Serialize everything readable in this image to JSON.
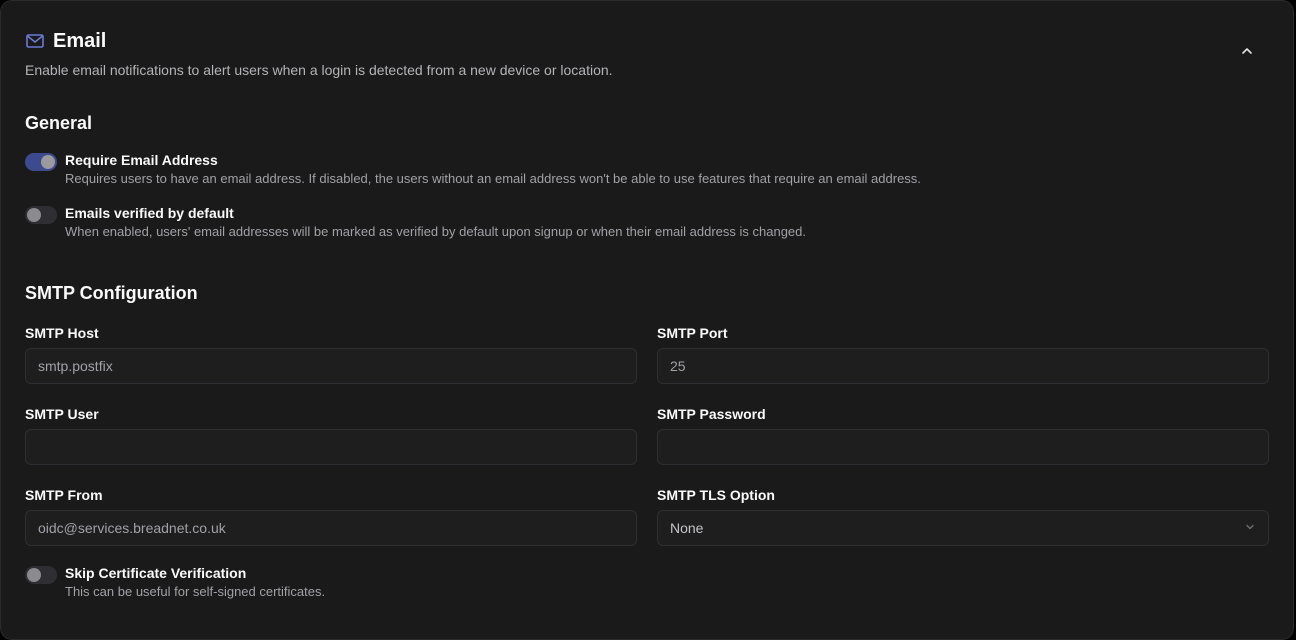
{
  "header": {
    "title": "Email",
    "subtitle": "Enable email notifications to alert users when a login is detected from a new device or location."
  },
  "general": {
    "title": "General",
    "toggles": [
      {
        "label": "Require Email Address",
        "description": "Requires users to have an email address. If disabled, the users without an email address won't be able to use features that require an email address.",
        "enabled": true
      },
      {
        "label": "Emails verified by default",
        "description": "When enabled, users' email addresses will be marked as verified by default upon signup or when their email address is changed.",
        "enabled": false
      }
    ]
  },
  "smtp": {
    "title": "SMTP Configuration",
    "host": {
      "label": "SMTP Host",
      "value": "smtp.postfix"
    },
    "port": {
      "label": "SMTP Port",
      "value": "25"
    },
    "user": {
      "label": "SMTP User",
      "value": ""
    },
    "password": {
      "label": "SMTP Password",
      "value": ""
    },
    "from": {
      "label": "SMTP From",
      "value": "oidc@services.breadnet.co.uk"
    },
    "tls": {
      "label": "SMTP TLS Option",
      "value": "None"
    },
    "skip_verification": {
      "label": "Skip Certificate Verification",
      "description": "This can be useful for self-signed certificates.",
      "enabled": false
    }
  },
  "colors": {
    "accent": "#3d4a8f",
    "icon": "#6b7bd6",
    "background": "#1a1a1a"
  },
  "icons": {
    "header": "mail-icon",
    "collapse": "chevron-up-icon",
    "select": "chevron-down-icon"
  }
}
